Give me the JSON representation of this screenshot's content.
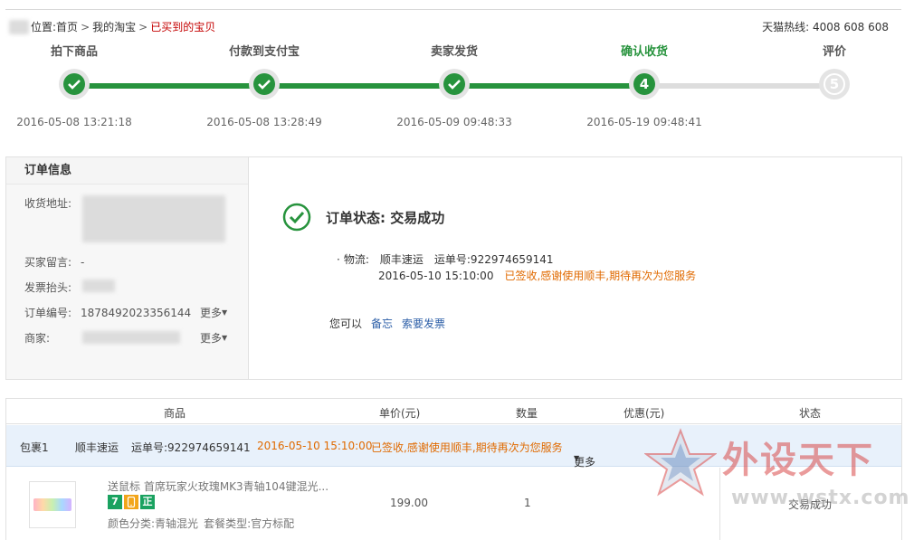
{
  "breadcrumb": {
    "prefix": "位置:",
    "separator": ">",
    "items": [
      "首页",
      "我的淘宝"
    ],
    "current": "已买到的宝贝"
  },
  "hotline": "天猫热线: 4008 608 608",
  "steps": [
    {
      "label": "拍下商品",
      "time": "2016-05-08 13:21:18",
      "state": "done"
    },
    {
      "label": "付款到支付宝",
      "time": "2016-05-08 13:28:49",
      "state": "done"
    },
    {
      "label": "卖家发货",
      "time": "2016-05-09 09:48:33",
      "state": "done"
    },
    {
      "label": "确认收货",
      "time": "2016-05-19 09:48:41",
      "state": "current",
      "number": "4"
    },
    {
      "label": "评价",
      "time": "",
      "state": "todo",
      "number": "5"
    }
  ],
  "order_info": {
    "title": "订单信息",
    "address_label": "收货地址:",
    "buyer_message_label": "买家留言:",
    "buyer_message": "-",
    "invoice_label": "发票抬头:",
    "order_no_label": "订单编号:",
    "order_no": "1878492023356144",
    "more": "更多",
    "seller_label": "商家:"
  },
  "status": {
    "text": "订单状态: 交易成功",
    "logistics_label": "物流:",
    "carrier": "顺丰速运",
    "tracking": "运单号:922974659141",
    "time": "2016-05-10 15:10:00",
    "message": "已签收,感谢使用顺丰,期待再次为您服务",
    "actions_label": "您可以",
    "action_note": "备忘",
    "action_invoice": "索要发票"
  },
  "table": {
    "headers": {
      "goods": "商品",
      "price": "单价(元)",
      "qty": "数量",
      "discount": "优惠(元)",
      "status": "状态"
    },
    "package": {
      "name": "包裹1",
      "carrier": "顺丰速运",
      "tracking": "运单号:922974659141",
      "time": "2016-05-10 15:10:00",
      "message": "已签收,感谢使用顺丰,期待再次为您服务",
      "more": "更多"
    },
    "item": {
      "title": "送鼠标 首席玩家火玫瑰MK3青轴104键混光...",
      "badges": [
        "7",
        "正"
      ],
      "attr_color_label": "颜色分类:",
      "attr_color": "青轴混光",
      "attr_set_label": "套餐类型:",
      "attr_set": "官方标配",
      "price": "199.00",
      "qty": "1",
      "status": "交易成功"
    }
  },
  "watermark": {
    "title": "外设天下",
    "url": "www.wstx.com"
  },
  "colors": {
    "green": "#27933d",
    "orange": "#e06a00",
    "red": "#c40000",
    "link": "#2d5fa8",
    "package_bg": "#e8f1fb"
  }
}
